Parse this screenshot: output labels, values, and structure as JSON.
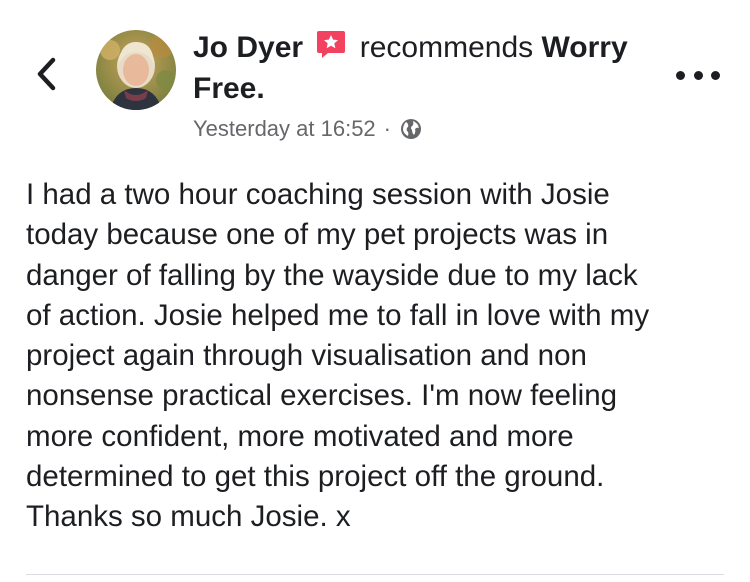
{
  "header": {
    "back_icon": "chevron-left-icon",
    "author": "Jo Dyer",
    "recommend_icon": "recommend-star-badge-icon",
    "action": "recommends",
    "page": "Worry Free.",
    "timestamp": "Yesterday at 16:52",
    "separator": "·",
    "privacy_icon": "globe-icon",
    "more_icon": "more-options-icon"
  },
  "post": {
    "text": "I had a two hour coaching session with Josie\ntoday because one of my pet projects was in\ndanger of falling by the wayside due to my lack\nof action.  Josie helped me to fall in love with my\nproject again through visualisation and non\nnonsense practical exercises.  I'm now feeling\nmore confident, more motivated and more\ndetermined to get this project off the ground.\nThanks so much Josie. x"
  },
  "colors": {
    "text": "#1c1e21",
    "meta": "#65676b",
    "badge": "#f3425f",
    "divider": "#dadde1"
  }
}
